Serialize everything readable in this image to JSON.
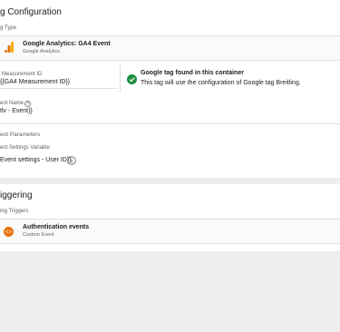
{
  "tag_configuration": {
    "heading": "g Configuration",
    "tag_type_label": "g Type",
    "tag_type": {
      "name": "Google Analytics: GA4 Event",
      "vendor": "Google Analytics",
      "icon": "google-analytics-icon"
    },
    "measurement_id": {
      "label": "Measurement ID",
      "value": "{{GA4 Measurement ID}}"
    },
    "google_tag_status": {
      "title": "Google tag found in this container",
      "description": "This tag will use the configuration of Google tag Breitling.",
      "icon": "check-circle-icon",
      "icon_color": "#1e8e3e"
    },
    "event_name": {
      "label": "ent Name",
      "help_icon": "help-circle-icon",
      "value": "tlv - Event}}"
    },
    "event_parameters": {
      "label": "ent Parameters"
    },
    "event_settings_variable": {
      "label": "ent Settings Variable",
      "value": "Event settings - User ID}}",
      "info_icon": "info-circle-icon"
    }
  },
  "triggering": {
    "heading": "iggering",
    "firing_triggers_label": "ing Triggers",
    "trigger": {
      "name": "Authentication events",
      "type": "Custom Event",
      "icon": "custom-event-icon",
      "icon_color": "#e8710a"
    }
  }
}
